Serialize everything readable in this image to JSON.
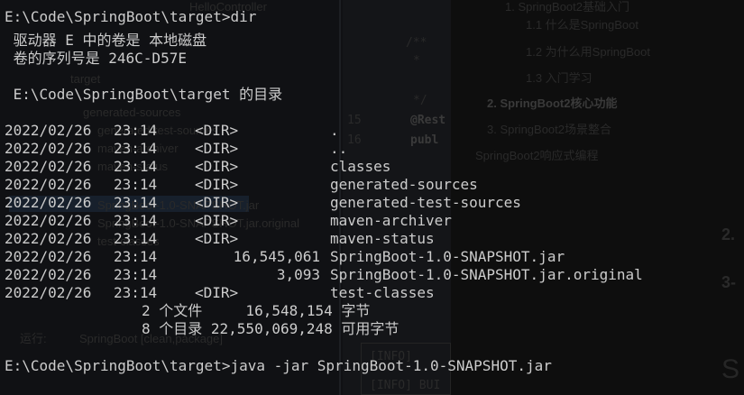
{
  "background": {
    "ide_tab": "HelloController",
    "project_node": "target",
    "tree_items": [
      "generated-sources",
      "generated-test-sources",
      "maven-archiver",
      "maven-status",
      "SpringBoot-1.0-SNAPSHOT.jar",
      "SpringBoot-1.0-SNAPSHOT.jar.original",
      "test-classes"
    ],
    "editor_lines": [
      "/**",
      "*",
      "*/",
      "@Rest",
      "publ",
      "15",
      "16"
    ],
    "run_label": "运行:",
    "run_target": "SpringBoot [clean,package]",
    "console_lines": [
      "[INFO]",
      "[INFO] BUI"
    ],
    "outline": [
      {
        "text": "1. SpringBoot2基础入门",
        "bold": false
      },
      {
        "text": "1.1 什么是SpringBoot",
        "bold": false
      },
      {
        "text": "1.2 为什么用SpringBoot",
        "bold": false
      },
      {
        "text": "1.3 入门学习",
        "bold": false
      },
      {
        "text": "2. SpringBoot2核心功能",
        "bold": true
      },
      {
        "text": "3. SpringBoot2场景整合",
        "bold": false
      },
      {
        "text": "SpringBoot2响应式编程",
        "bold": false
      }
    ],
    "side_marks": [
      "2.",
      "3-",
      "S"
    ]
  },
  "terminal": {
    "prompt_dir": "E:\\Code\\SpringBoot\\target>dir",
    "volume_line": " 驱动器 E 中的卷是 本地磁盘",
    "serial_line": " 卷的序列号是 246C-D57E",
    "listing_header": " E:\\Code\\SpringBoot\\target 的目录",
    "entries": [
      {
        "date": "2022/02/26",
        "time": "23:14",
        "type": "<DIR>",
        "size": "",
        "name": "."
      },
      {
        "date": "2022/02/26",
        "time": "23:14",
        "type": "<DIR>",
        "size": "",
        "name": ".."
      },
      {
        "date": "2022/02/26",
        "time": "23:14",
        "type": "<DIR>",
        "size": "",
        "name": "classes"
      },
      {
        "date": "2022/02/26",
        "time": "23:14",
        "type": "<DIR>",
        "size": "",
        "name": "generated-sources"
      },
      {
        "date": "2022/02/26",
        "time": "23:14",
        "type": "<DIR>",
        "size": "",
        "name": "generated-test-sources"
      },
      {
        "date": "2022/02/26",
        "time": "23:14",
        "type": "<DIR>",
        "size": "",
        "name": "maven-archiver"
      },
      {
        "date": "2022/02/26",
        "time": "23:14",
        "type": "<DIR>",
        "size": "",
        "name": "maven-status"
      },
      {
        "date": "2022/02/26",
        "time": "23:14",
        "type": "",
        "size": "16,545,061",
        "name": "SpringBoot-1.0-SNAPSHOT.jar"
      },
      {
        "date": "2022/02/26",
        "time": "23:14",
        "type": "",
        "size": "3,093",
        "name": "SpringBoot-1.0-SNAPSHOT.jar.original"
      },
      {
        "date": "2022/02/26",
        "time": "23:14",
        "type": "<DIR>",
        "size": "",
        "name": "test-classes"
      }
    ],
    "summary_files": "2 个文件     16,548,154 字节",
    "summary_dirs": "8 个目录 22,550,069,248 可用字节",
    "prompt_java": "E:\\Code\\SpringBoot\\target>java -jar SpringBoot-1.0-SNAPSHOT.jar"
  }
}
